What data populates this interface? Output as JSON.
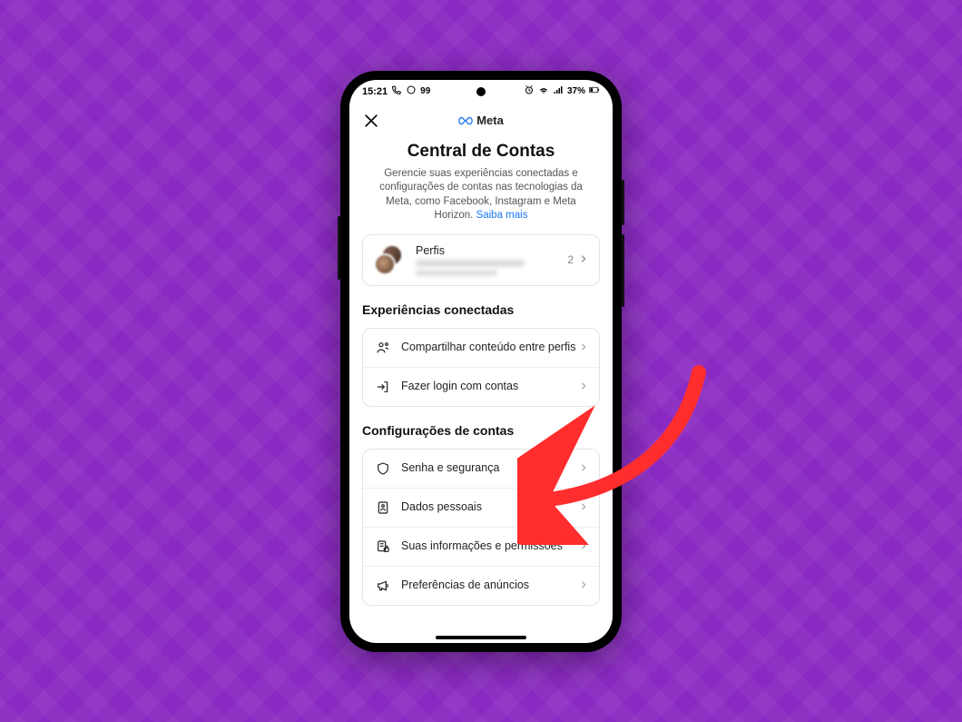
{
  "statusbar": {
    "time": "15:21",
    "battery_pct": "37%"
  },
  "header": {
    "brand": "Meta"
  },
  "page": {
    "title": "Central de Contas",
    "description": "Gerencie suas experiências conectadas e configurações de contas nas tecnologias da Meta, como Facebook, Instagram e Meta Horizon. ",
    "learn_more": "Saiba mais"
  },
  "profiles": {
    "label": "Perfis",
    "count": "2"
  },
  "sections": {
    "connected": {
      "heading": "Experiências conectadas",
      "items": [
        {
          "label": "Compartilhar conteúdo entre perfis"
        },
        {
          "label": "Fazer login com contas"
        }
      ]
    },
    "account_settings": {
      "heading": "Configurações de contas",
      "items": [
        {
          "label": "Senha e segurança"
        },
        {
          "label": "Dados pessoais"
        },
        {
          "label": "Suas informações e permissões"
        },
        {
          "label": "Preferências de anúncios"
        }
      ]
    }
  }
}
